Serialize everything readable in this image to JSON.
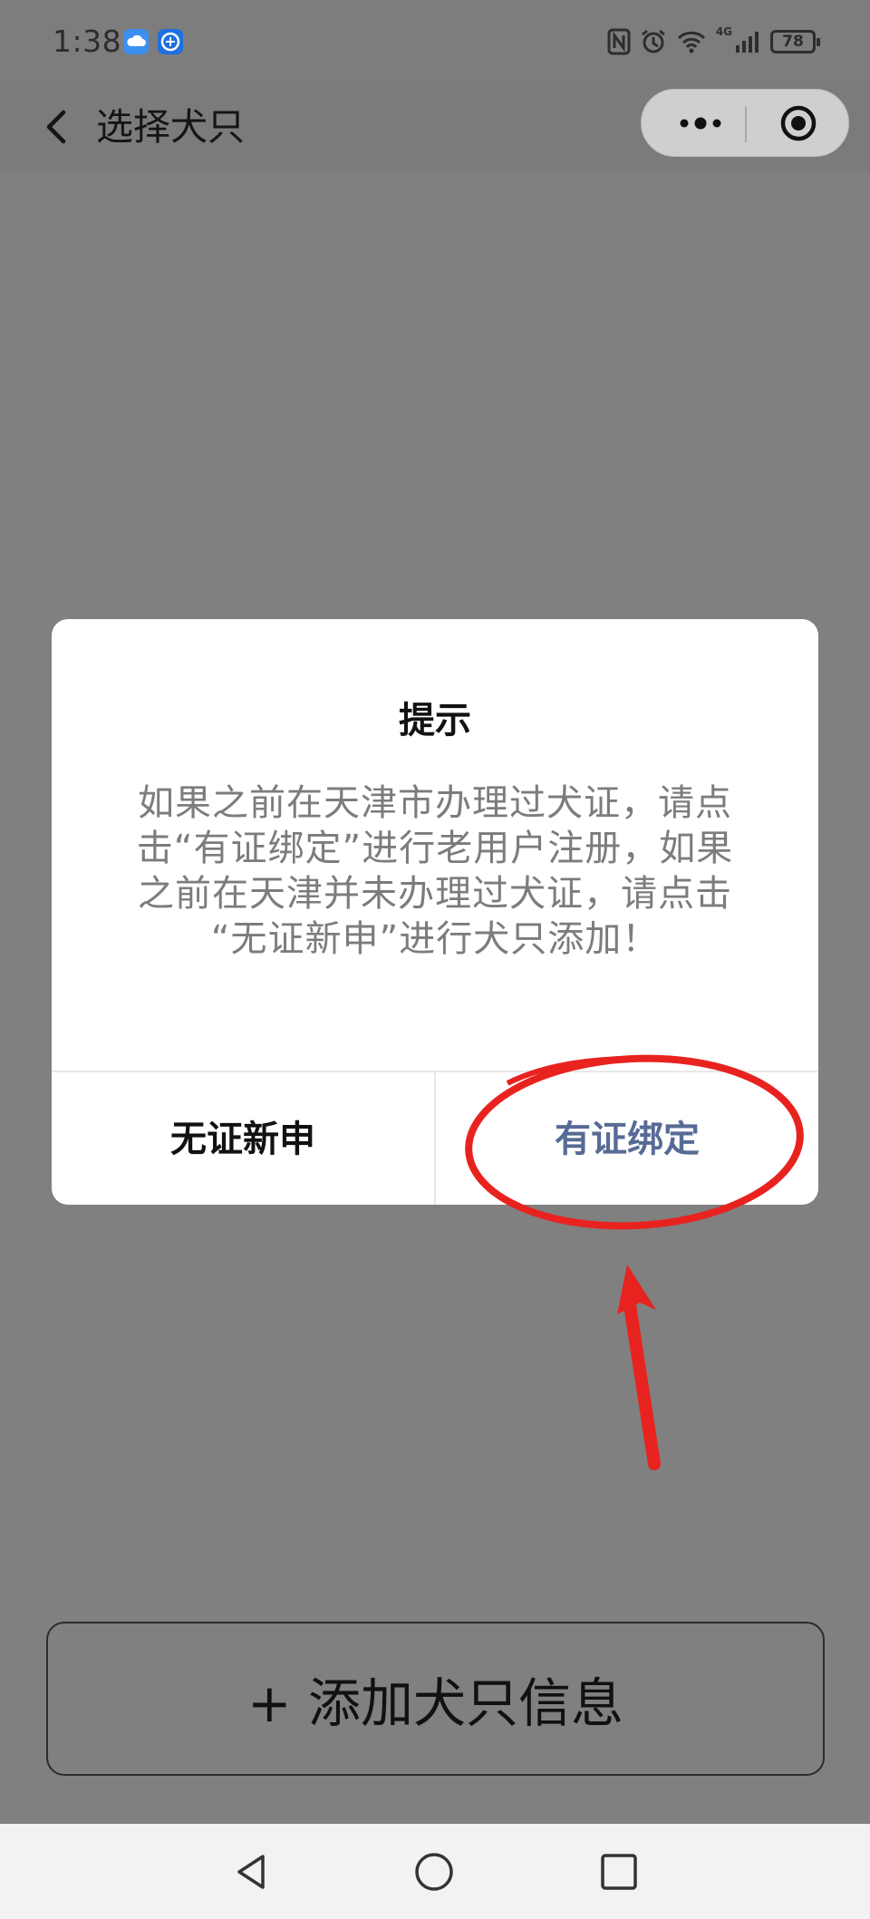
{
  "status_bar": {
    "time": "1:38",
    "network": "4G",
    "battery": "78"
  },
  "nav": {
    "title": "选择犬只"
  },
  "dialog": {
    "title": "提示",
    "body_lines": [
      "如果之前在天津市办理过犬证，请点",
      "击“有证绑定”进行老用户注册，如果",
      "之前在天津并未办理过犬证，请点击",
      "“无证新申”进行犬只添加！"
    ],
    "cancel_label": "无证新申",
    "confirm_label": "有证绑定"
  },
  "add_button": {
    "label": "+ 添加犬只信息"
  },
  "colors": {
    "overlay": "#808080",
    "dialog_bg": "#ffffff",
    "confirm_text": "#576b95",
    "annotation": "#e8231f"
  },
  "icons": {
    "back": "chevron-left-icon",
    "more": "more-dots-icon",
    "close": "target-close-icon",
    "sys_back": "triangle-back-icon",
    "sys_home": "circle-home-icon",
    "sys_recents": "square-recents-icon"
  }
}
